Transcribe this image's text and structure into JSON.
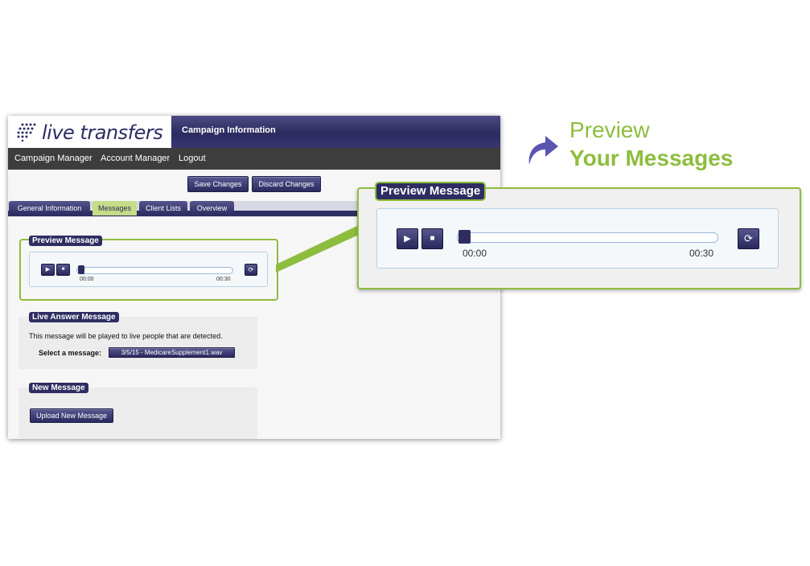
{
  "app": {
    "logo": "live transfers",
    "title": "Campaign Information",
    "nav": [
      "Campaign Manager",
      "Account Manager",
      "Logout"
    ],
    "actions": {
      "save": "Save Changes",
      "discard": "Discard Changes"
    },
    "tabs": [
      "General Information",
      "Messages",
      "Client Lists",
      "Overview"
    ],
    "active_tab": "Messages"
  },
  "preview": {
    "label": "Preview Message",
    "play_icon": "▶",
    "stop_icon": "■",
    "loop_icon": "⟳",
    "start_time": "00:00",
    "end_time": "00:30",
    "progress": 0
  },
  "live_answer": {
    "label": "Live Answer Message",
    "description": "This message will be played to live people that are detected.",
    "select_label": "Select a message:",
    "selected": "3/5/15 - MedicareSupplement1.wav"
  },
  "new_message": {
    "label": "New Message",
    "upload": "Upload New Message"
  },
  "promo": {
    "line1": "Preview",
    "line2": "Your Messages"
  },
  "colors": {
    "navy": "#2e2d62",
    "green": "#8dbd3e",
    "arrow": "#5a56b0"
  }
}
